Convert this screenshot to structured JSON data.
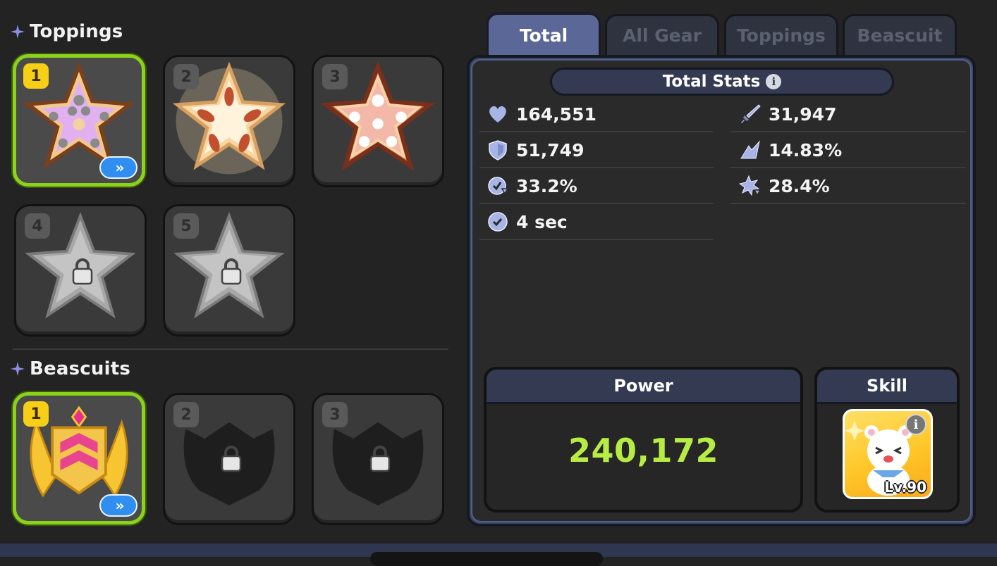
{
  "toppings": {
    "title": "Toppings",
    "slots": [
      {
        "number": "1",
        "state": "equipped"
      },
      {
        "number": "2",
        "state": "equipped"
      },
      {
        "number": "3",
        "state": "equipped"
      },
      {
        "number": "4",
        "state": "locked"
      },
      {
        "number": "5",
        "state": "locked"
      }
    ]
  },
  "beascuits": {
    "title": "Beascuits",
    "slots": [
      {
        "number": "1",
        "state": "equipped"
      },
      {
        "number": "2",
        "state": "locked"
      },
      {
        "number": "3",
        "state": "locked"
      }
    ]
  },
  "upgrade_label": "»",
  "tabs": [
    {
      "label": "Total",
      "active": true
    },
    {
      "label": "All Gear",
      "active": false
    },
    {
      "label": "Toppings",
      "active": false
    },
    {
      "label": "Beascuit",
      "active": false
    }
  ],
  "total_stats": {
    "title": "Total Stats",
    "info_glyph": "i",
    "left": [
      {
        "icon": "heart-icon",
        "value": "164,551"
      },
      {
        "icon": "shield-icon",
        "value": "51,749"
      },
      {
        "icon": "cooldown-icon",
        "value": "33.2%"
      },
      {
        "icon": "clock-icon",
        "value": "4 sec"
      }
    ],
    "right": [
      {
        "icon": "sword-icon",
        "value": "31,947"
      },
      {
        "icon": "crit-icon",
        "value": "14.83%"
      },
      {
        "icon": "damage-resist-icon",
        "value": "28.4%"
      }
    ]
  },
  "power": {
    "label": "Power",
    "value": "240,172"
  },
  "skill": {
    "label": "Skill",
    "level": "Lv.90",
    "info_glyph": "i"
  },
  "colors": {
    "accent_green": "#8bd21c",
    "power_green": "#b6ec43",
    "tab_active": "#5b6797",
    "upgrade_blue": "#2f8ef0",
    "badge_yellow": "#f7cf16"
  }
}
